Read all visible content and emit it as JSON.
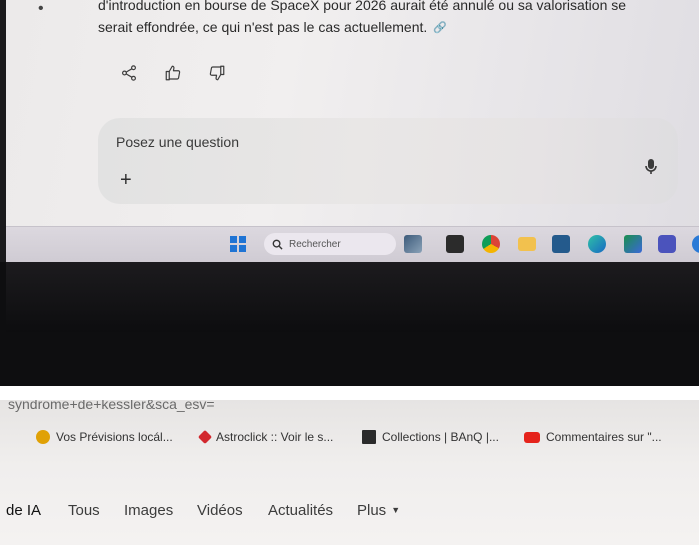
{
  "answer": {
    "line1": "d'introduction en bourse de SpaceX pour 2026 aurait été annulé ou sa valorisation se",
    "line2": "serait effondrée, ce qui n'est pas le cas actuellement."
  },
  "actions": {
    "share_icon": "share-icon",
    "like_icon": "thumbs-up-icon",
    "dislike_icon": "thumbs-down-icon"
  },
  "composer": {
    "placeholder": "Posez une question",
    "plus_label": "+"
  },
  "taskbar": {
    "search_label": "Rechercher"
  },
  "browser": {
    "url_fragment": "syndrome+de+kessler&sca_esv=",
    "bookmarks": [
      {
        "label": "Vos Prévisions locál...",
        "color": "#e0a106"
      },
      {
        "label": "Astroclick :: Voir le s...",
        "color": "#d2282e"
      },
      {
        "label": "Collections | BAnQ |...",
        "color": "#2b2b2b"
      },
      {
        "label": "Commentaires sur \"...",
        "color": "#e5231b"
      }
    ],
    "search_tabs": [
      {
        "label": "de IA"
      },
      {
        "label": "Tous"
      },
      {
        "label": "Images"
      },
      {
        "label": "Vidéos"
      },
      {
        "label": "Actualités"
      },
      {
        "label": "Plus"
      }
    ]
  },
  "colors": {
    "windows_blue": "#1f74d4",
    "youtube_red": "#e5231b"
  }
}
